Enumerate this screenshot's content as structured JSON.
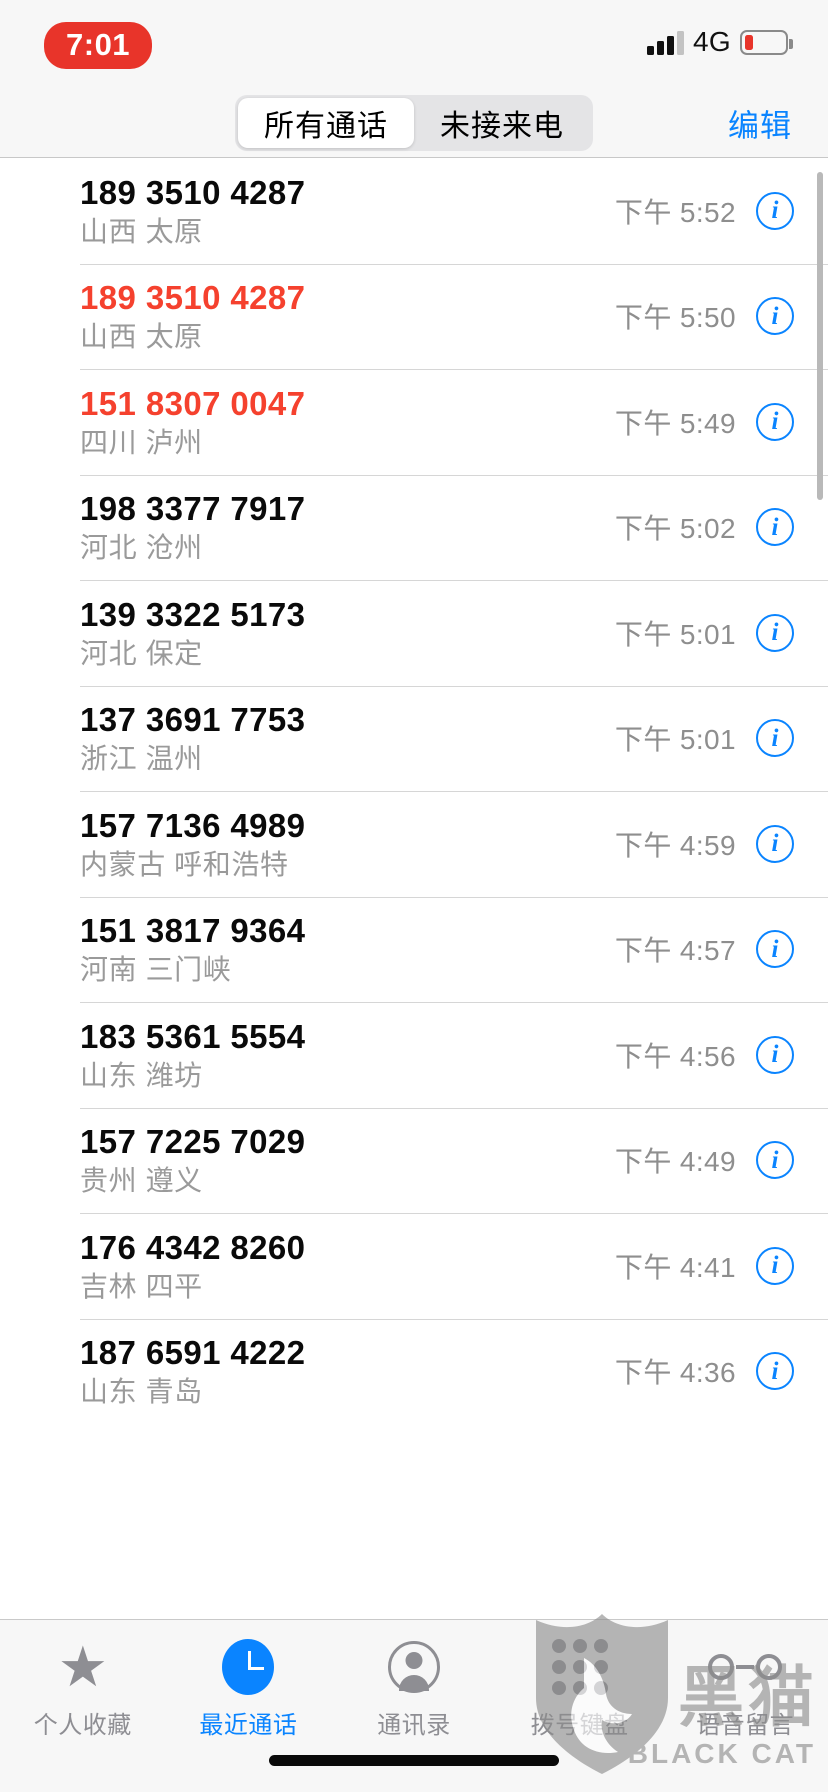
{
  "status_bar": {
    "time": "7:01",
    "carrier_network": "4G",
    "signal_icon": "cellular-signal-icon",
    "battery_icon": "battery-low-icon",
    "time_pill_color": "#e8342a"
  },
  "nav_bar": {
    "segments": [
      {
        "label": "所有通话",
        "selected": true
      },
      {
        "label": "未接来电",
        "selected": false
      }
    ],
    "edit_label": "编辑",
    "accent_color": "#0a84ff"
  },
  "calls": [
    {
      "number": "189 3510 4287",
      "locale": "山西 太原",
      "time": "下午 5:52",
      "missed": false
    },
    {
      "number": "189 3510 4287",
      "locale": "山西 太原",
      "time": "下午 5:50",
      "missed": true
    },
    {
      "number": "151 8307 0047",
      "locale": "四川 泸州",
      "time": "下午 5:49",
      "missed": true
    },
    {
      "number": "198 3377 7917",
      "locale": "河北 沧州",
      "time": "下午 5:02",
      "missed": false
    },
    {
      "number": "139 3322 5173",
      "locale": "河北 保定",
      "time": "下午 5:01",
      "missed": false
    },
    {
      "number": "137 3691 7753",
      "locale": "浙江 温州",
      "time": "下午 5:01",
      "missed": false
    },
    {
      "number": "157 7136 4989",
      "locale": "内蒙古 呼和浩特",
      "time": "下午 4:59",
      "missed": false
    },
    {
      "number": "151 3817 9364",
      "locale": "河南 三门峡",
      "time": "下午 4:57",
      "missed": false
    },
    {
      "number": "183 5361 5554",
      "locale": "山东 潍坊",
      "time": "下午 4:56",
      "missed": false
    },
    {
      "number": "157 7225 7029",
      "locale": "贵州 遵义",
      "time": "下午 4:49",
      "missed": false
    },
    {
      "number": "176 4342 8260",
      "locale": "吉林 四平",
      "time": "下午 4:41",
      "missed": false
    },
    {
      "number": "187 6591 4222",
      "locale": "山东 青岛",
      "time": "下午 4:36",
      "missed": false
    }
  ],
  "missed_call_color": "#f5412e",
  "info_button_label": "i",
  "tab_bar": {
    "tabs": [
      {
        "label": "个人收藏",
        "icon": "star-icon",
        "active": false
      },
      {
        "label": "最近通话",
        "icon": "recents-clock-icon",
        "active": true
      },
      {
        "label": "通讯录",
        "icon": "contacts-person-icon",
        "active": false
      },
      {
        "label": "拨号键盘",
        "icon": "keypad-icon",
        "active": false
      },
      {
        "label": "语音留言",
        "icon": "voicemail-icon",
        "active": false
      }
    ]
  },
  "watermark": {
    "text_cn": "黑猫",
    "text_en": "BLACK CAT"
  }
}
